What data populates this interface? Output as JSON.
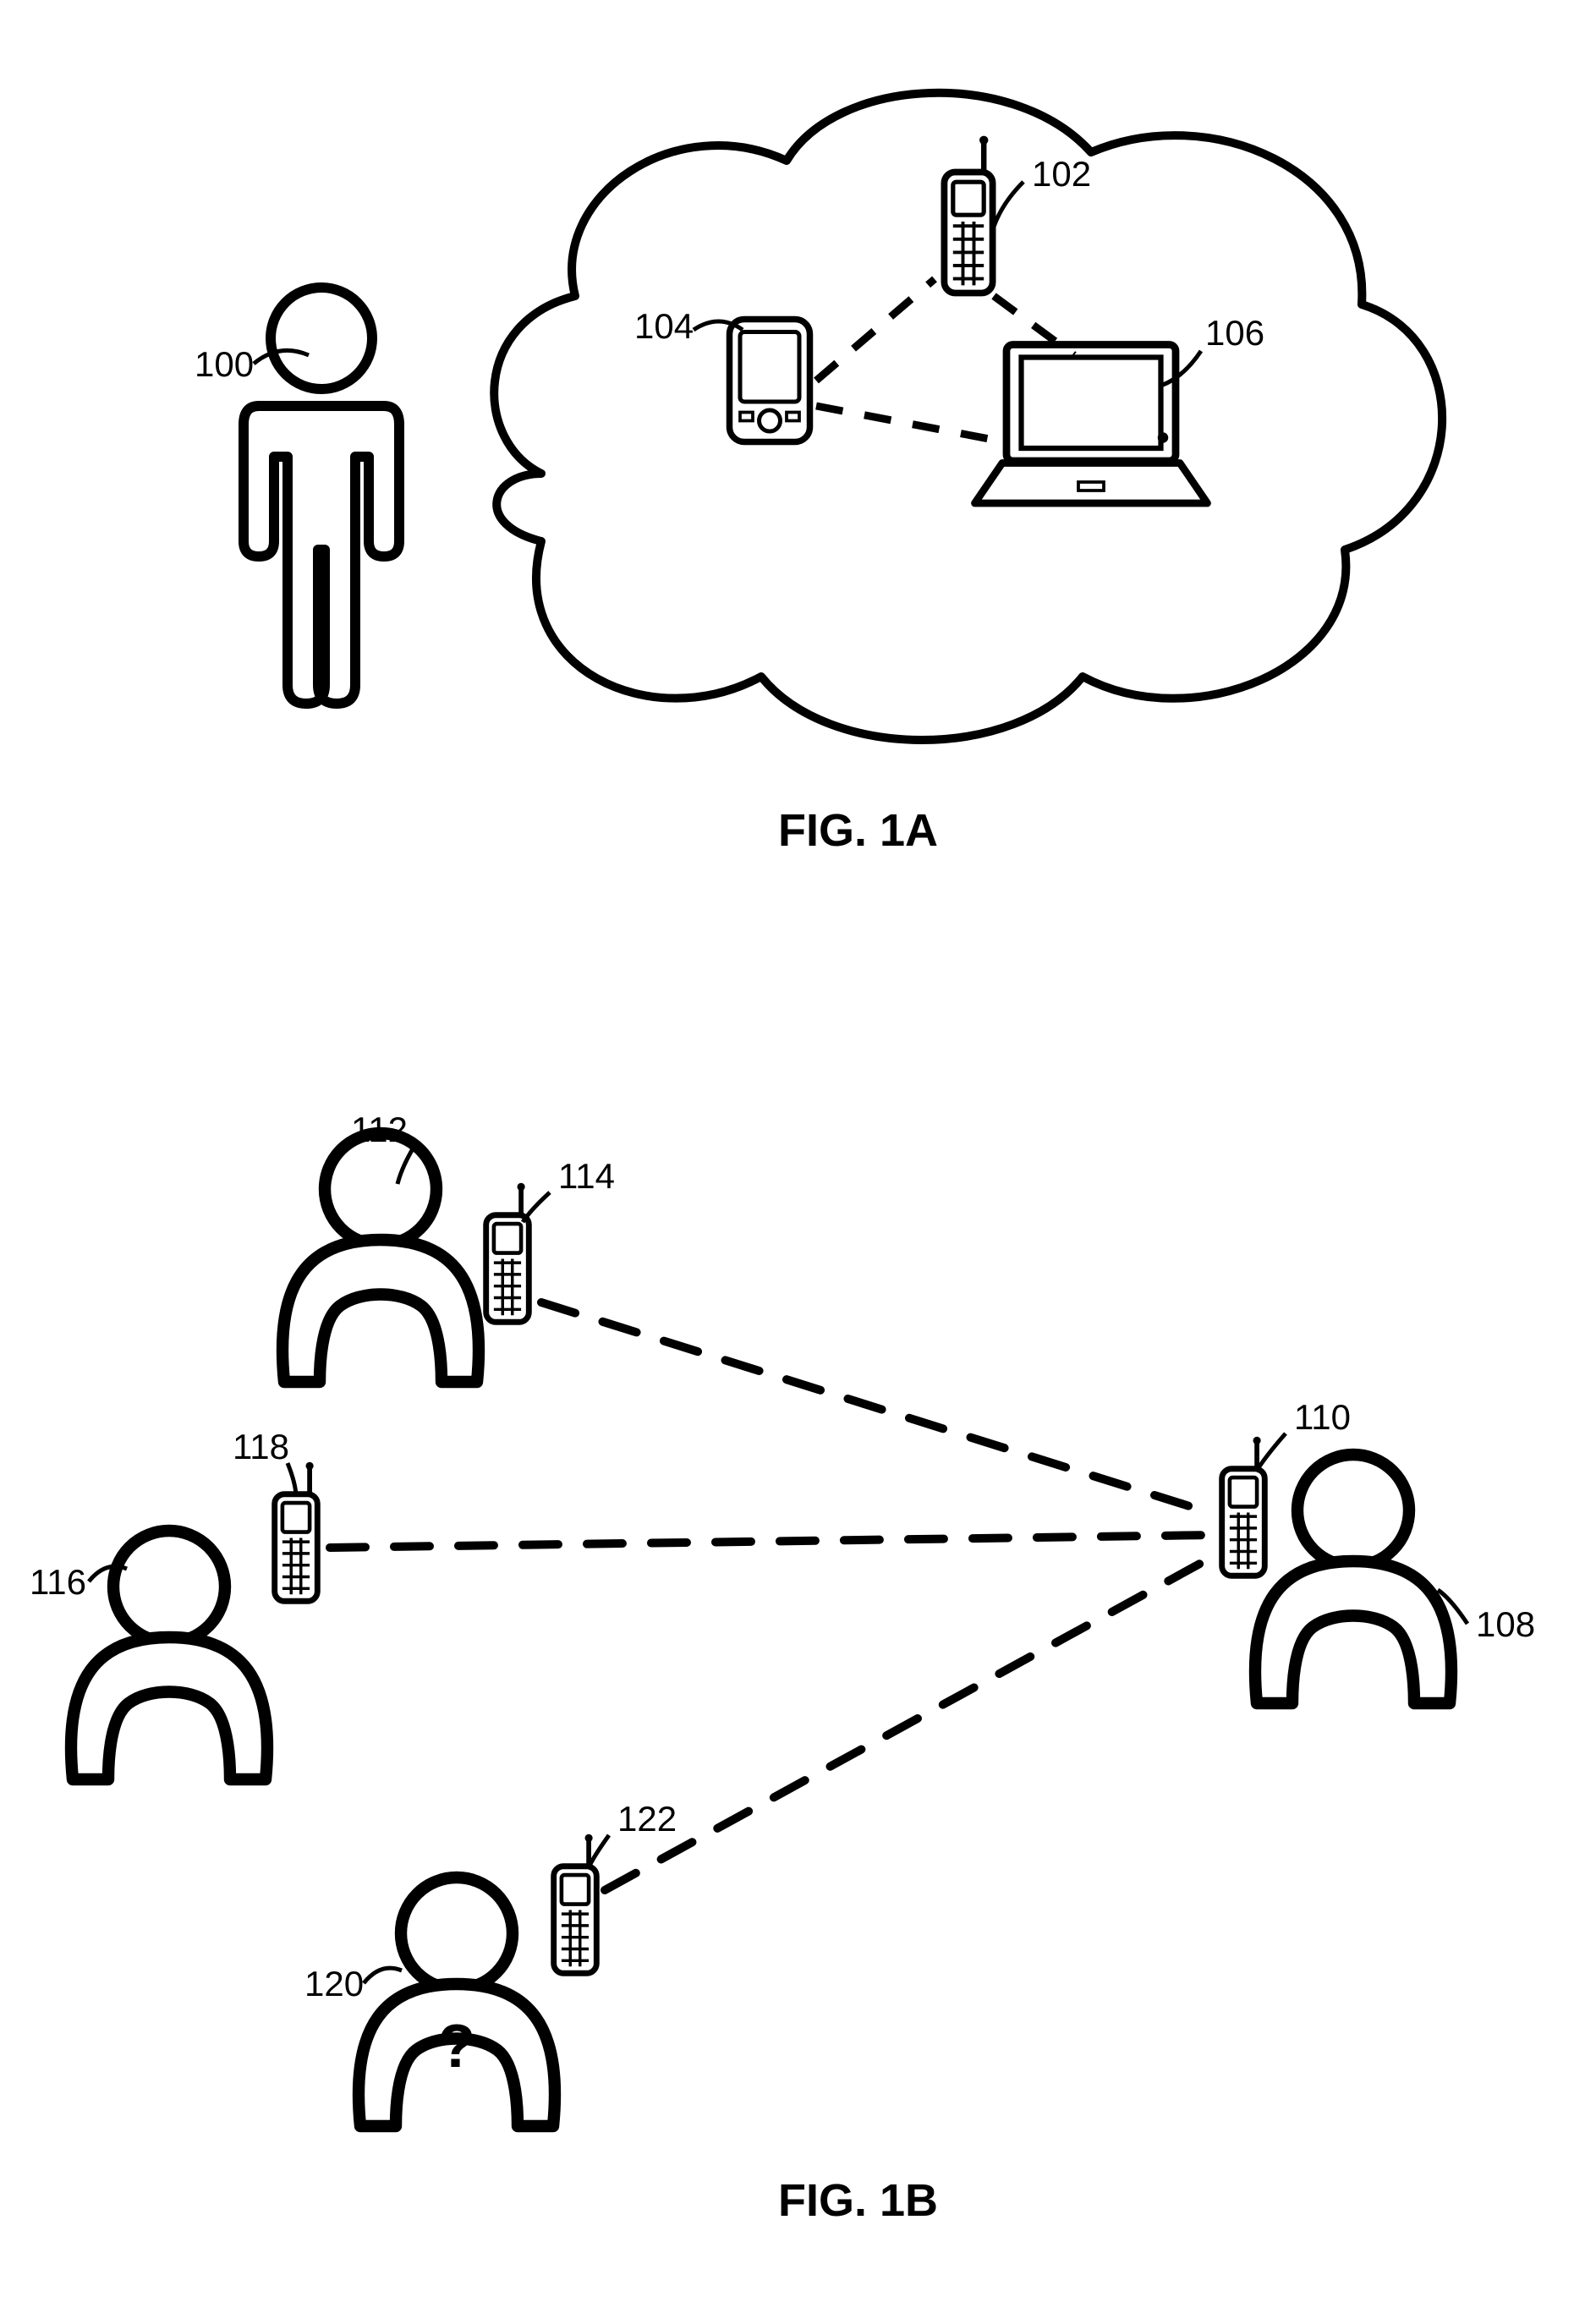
{
  "fig1a": {
    "caption": "FIG. 1A"
  },
  "fig1b": {
    "caption": "FIG. 1B"
  },
  "refs": {
    "r100": "100",
    "r102": "102",
    "r104": "104",
    "r106": "106",
    "r108": "108",
    "r110": "110",
    "r112": "112",
    "r114": "114",
    "r116": "116",
    "r118": "118",
    "r120": "120",
    "r122": "122"
  },
  "symbols": {
    "unknown_person": "?"
  }
}
